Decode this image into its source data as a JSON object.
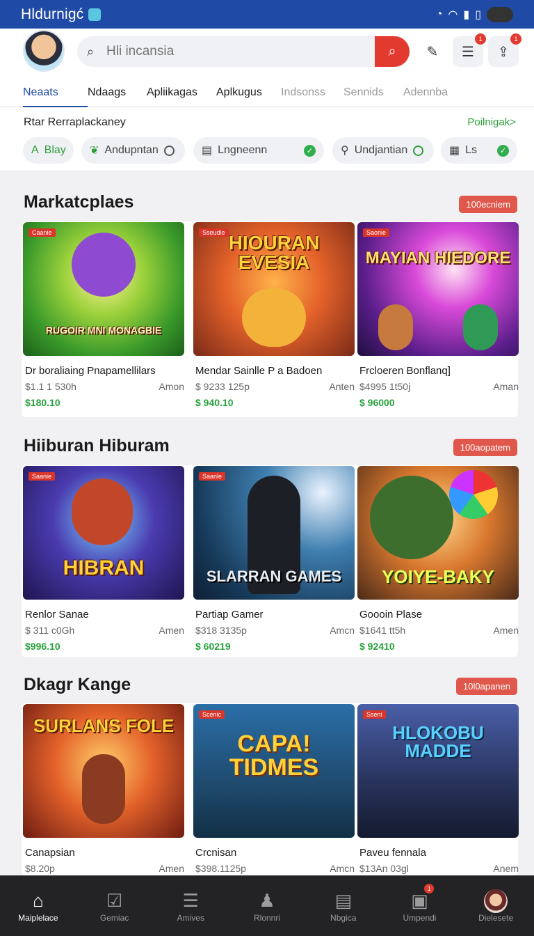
{
  "status_bar": {
    "title": "Hldurnigć",
    "icons": [
      "clock-icon",
      "wifi-icon",
      "signal-icon",
      "battery-icon"
    ]
  },
  "header": {
    "search": {
      "placeholder": "Hli incansia"
    },
    "badges": {
      "notifications": "1",
      "share": "1"
    }
  },
  "tabs": [
    {
      "label": "Neaats",
      "active": true
    },
    {
      "label": "Ndaags"
    },
    {
      "label": "Apliikagas"
    },
    {
      "label": "Aplkugus"
    },
    {
      "label": "Indsonss"
    },
    {
      "label": "Sennids"
    },
    {
      "label": "Adennba"
    }
  ],
  "filters": {
    "label": "Rtar Rerraplackaney",
    "more": "Poilnigak>",
    "chips": [
      {
        "label": "Blay",
        "lead": "A"
      },
      {
        "label": "Andupntan"
      },
      {
        "label": "Lngneenn"
      },
      {
        "label": "Undjantian"
      },
      {
        "label": "Ls"
      }
    ]
  },
  "sections": [
    {
      "title": "Markatcplaes",
      "pill": "100ecniem",
      "cards": [
        {
          "tag": "Caanie",
          "art": "RUGOIR MNI MONAGBIE",
          "name": "Dr boraliaing Pnapamellilars",
          "meta": "$1.1 1 530h",
          "seller": "Amon",
          "price": "$180.10"
        },
        {
          "tag": "Sseudie",
          "art": "HIOURAN EVESIA",
          "name": "Mendar Sainlle P a Badoen",
          "meta": "$ 9233 125p",
          "seller": "Anten",
          "price": "$ 940.10"
        },
        {
          "tag": "Saonie",
          "art": "MAYIAN HIEDORE",
          "name": "Frcloeren Bonflanq]",
          "meta": "$4995 1t50j",
          "seller": "Aman",
          "price": "$ 96000"
        }
      ]
    },
    {
      "title": "Hiiburan Hiburam",
      "pill": "100aopatem",
      "cards": [
        {
          "tag": "Saanie",
          "art": "HIBRAN",
          "name": "Renlor Sanae",
          "meta": "$ 311 c0Gh",
          "seller": "Amen",
          "price": "$996.10"
        },
        {
          "tag": "Saanle",
          "art": "SLARRAN GAMES",
          "name": "Partiap Gamer",
          "meta": "$318 3135p",
          "seller": "Amcn",
          "price": "$ 60219"
        },
        {
          "tag": "",
          "art": "YOIYE-BAKY",
          "name": "Goooin Plase",
          "meta": "$1641 tt5h",
          "seller": "Amen",
          "price": "$ 92410"
        }
      ]
    },
    {
      "title": "Dkagr Kange",
      "pill": "10l0apanen",
      "cards": [
        {
          "tag": "",
          "art": "SURLANS FOLE",
          "name": "Canapsian",
          "meta": "$8.20p",
          "seller": "Amen",
          "price": ""
        },
        {
          "tag": "Scenic",
          "art": "CAPA! TIDMES",
          "name": "Crcnisan",
          "meta": "$398.1125p",
          "seller": "Amcn",
          "price": ""
        },
        {
          "tag": "Sseni",
          "art": "HLOKOBU MADDE",
          "name": "Paveu fennala",
          "meta": "$13An 03gl",
          "seller": "Anem",
          "price": ""
        }
      ]
    }
  ],
  "bottom_nav": [
    {
      "label": "Maiplelace",
      "icon": "home-icon",
      "active": true
    },
    {
      "label": "Gemiac",
      "icon": "checkbox-icon"
    },
    {
      "label": "Amives",
      "icon": "menu-icon"
    },
    {
      "label": "Rlonnri",
      "icon": "person-icon"
    },
    {
      "label": "Nbgica",
      "icon": "cards-icon"
    },
    {
      "label": "Umpendi",
      "icon": "bag-icon",
      "badge": "1"
    },
    {
      "label": "Dielesete",
      "icon": "profile-avatar"
    }
  ],
  "colors": {
    "brand": "#1f4aa5",
    "accent": "#e23a2e",
    "price": "#27a13c"
  }
}
